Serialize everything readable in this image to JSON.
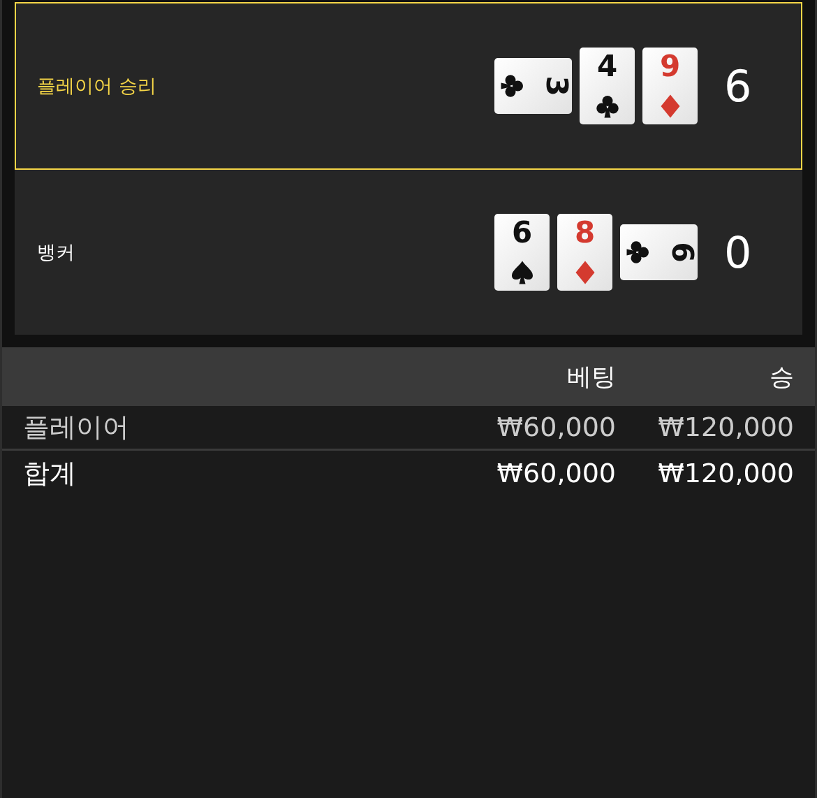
{
  "hands": [
    {
      "label": "플레이어 승리",
      "winner": true,
      "score": "6",
      "cards": [
        {
          "rank": "3",
          "kind": "clubs",
          "rotated": true
        },
        {
          "rank": "4",
          "kind": "clubs",
          "rotated": false
        },
        {
          "rank": "9",
          "kind": "diamonds",
          "rotated": false
        }
      ]
    },
    {
      "label": "뱅커",
      "winner": false,
      "score": "0",
      "cards": [
        {
          "rank": "6",
          "kind": "spades",
          "rotated": false
        },
        {
          "rank": "8",
          "kind": "diamonds",
          "rotated": false
        },
        {
          "rank": "6",
          "kind": "clubs",
          "rotated": true
        }
      ]
    }
  ],
  "table": {
    "columns": [
      "베팅",
      "승"
    ],
    "rows": [
      {
        "label": "플레이어",
        "bet": "₩60,000",
        "win": "₩120,000",
        "kind": "bet"
      },
      {
        "label": "합계",
        "bet": "₩60,000",
        "win": "₩120,000",
        "kind": "total"
      }
    ]
  }
}
